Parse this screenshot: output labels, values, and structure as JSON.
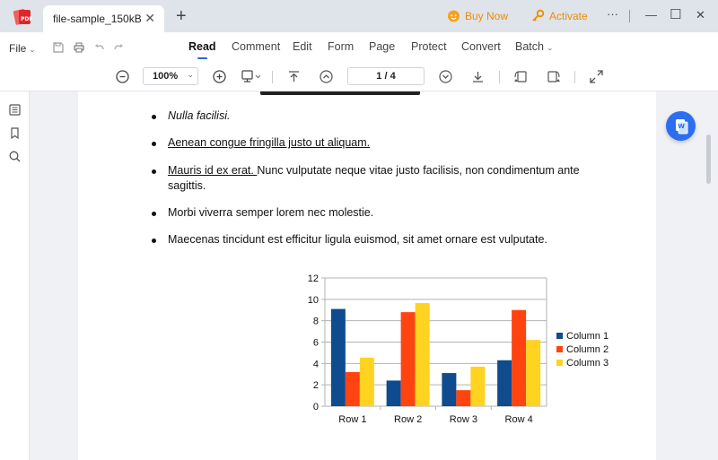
{
  "titlebar": {
    "tab_title": "file-sample_150kB",
    "tab_close": "✕",
    "new_tab": "+",
    "buy_now": "Buy Now",
    "activate": "Activate",
    "more": "···",
    "minimize": "—",
    "maximize": "☐",
    "close": "✕"
  },
  "menubar": {
    "file": "File",
    "tabs": [
      "Read",
      "Comment",
      "Edit",
      "Form",
      "Page",
      "Protect",
      "Convert",
      "Batch"
    ],
    "active_tab": "Read"
  },
  "toolbar": {
    "zoom": "100%",
    "page_indicator": "1 / 4"
  },
  "document": {
    "bullets": [
      {
        "text": "Nulla facilisi.",
        "style": "italic"
      },
      {
        "text": "Aenean congue fringilla justo ut aliquam. ",
        "style": "underline"
      },
      {
        "link": "Mauris id ex erat. ",
        "text": "Nunc vulputate neque vitae justo facilisis, non condimentum ante sagittis."
      },
      {
        "text": "Morbi viverra semper lorem nec molestie."
      },
      {
        "text": "Maecenas tincidunt est efficitur ligula euismod, sit amet ornare est vulputate."
      }
    ]
  },
  "colors": {
    "accent": "#2f5fde",
    "orange": "#f08a00",
    "series": [
      "#0f4b8f",
      "#ff4411",
      "#ffd320"
    ]
  },
  "chart_data": {
    "type": "bar",
    "categories": [
      "Row 1",
      "Row 2",
      "Row 3",
      "Row 4"
    ],
    "series": [
      {
        "name": "Column 1",
        "values": [
          9.1,
          2.4,
          3.1,
          4.3
        ]
      },
      {
        "name": "Column 2",
        "values": [
          3.2,
          8.8,
          1.5,
          9.0
        ]
      },
      {
        "name": "Column 3",
        "values": [
          4.54,
          9.65,
          3.7,
          6.2
        ]
      }
    ],
    "ylim": [
      0,
      12
    ],
    "yticks": [
      0,
      2,
      4,
      6,
      8,
      10,
      12
    ],
    "grid": true,
    "legend": "right"
  }
}
